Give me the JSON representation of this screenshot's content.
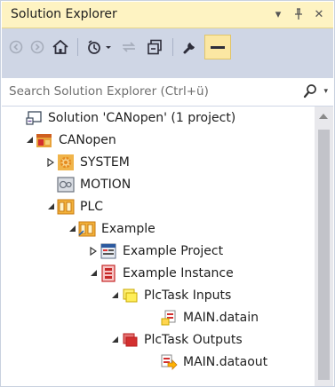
{
  "panel": {
    "title": "Solution Explorer",
    "dropdown_glyph": "▾",
    "pin_glyph": "⊥",
    "close_glyph": "✕"
  },
  "toolbar": {
    "icons": [
      "back-icon",
      "forward-icon",
      "home-icon",
      "history-icon",
      "sync-icon",
      "collapse-all-icon",
      "properties-wrench-icon",
      "preview-icon"
    ]
  },
  "search": {
    "placeholder": "Search Solution Explorer (Ctrl+ü)",
    "dropdown_glyph": "▾"
  },
  "tree": [
    {
      "label": "Solution 'CANopen' (1 project)",
      "expander": "none",
      "icon": "solution-icon"
    },
    {
      "label": "CANopen",
      "expander": "expanded",
      "icon": "project-icon"
    },
    {
      "label": "SYSTEM",
      "expander": "collapsed",
      "icon": "system-gear-icon"
    },
    {
      "label": "MOTION",
      "expander": "none",
      "icon": "motion-icon"
    },
    {
      "label": "PLC",
      "expander": "expanded",
      "icon": "plc-icon"
    },
    {
      "label": "Example",
      "expander": "expanded",
      "icon": "plc-project-icon"
    },
    {
      "label": "Example Project",
      "expander": "collapsed",
      "icon": "plc-code-icon"
    },
    {
      "label": "Example Instance",
      "expander": "expanded",
      "icon": "plc-instance-icon"
    },
    {
      "label": "PlcTask Inputs",
      "expander": "expanded",
      "icon": "inputs-folder-icon"
    },
    {
      "label": "MAIN.datain",
      "expander": "none",
      "icon": "input-variable-icon"
    },
    {
      "label": "PlcTask Outputs",
      "expander": "expanded",
      "icon": "outputs-folder-icon"
    },
    {
      "label": "MAIN.dataout",
      "expander": "none",
      "icon": "output-variable-icon"
    }
  ],
  "colors": {
    "title_bar": "#fef3c2",
    "toolbar": "#cfd6e5",
    "border": "#c9d1df",
    "text": "#1e1e1e"
  }
}
